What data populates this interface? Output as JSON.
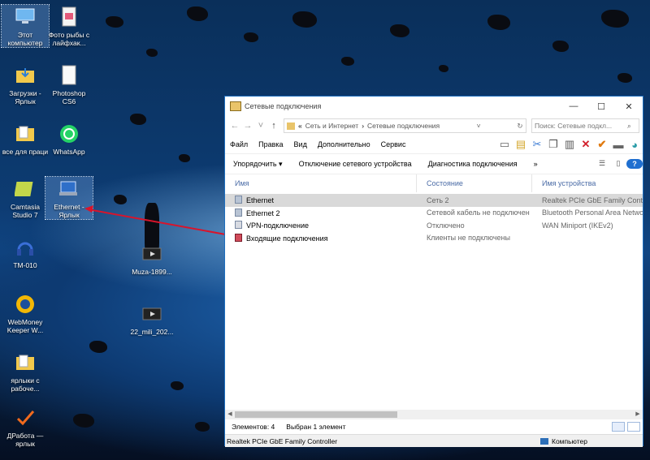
{
  "desktop": {
    "icons": [
      {
        "label": "Этот компьютер",
        "icon": "computer-icon"
      },
      {
        "label": "Фото рыбы с лайфхак...",
        "icon": "document-icon"
      },
      {
        "label": "Загрузки - Ярлык",
        "icon": "downloads-folder-icon"
      },
      {
        "label": "Photoshop CS6",
        "icon": "document-icon"
      },
      {
        "label": "все для праци",
        "icon": "folder-icon"
      },
      {
        "label": "WhatsApp",
        "icon": "whatsapp-icon"
      },
      {
        "label": "Camtasia Studio 7",
        "icon": "camtasia-icon"
      },
      {
        "label": "Ethernet - Ярлык",
        "icon": "network-shortcut-icon"
      },
      {
        "label": "TM-010",
        "icon": "headset-icon"
      },
      {
        "label": "Muza-1899...",
        "icon": "video-file-icon"
      },
      {
        "label": "WebMoney Keeper W...",
        "icon": "webmoney-icon"
      },
      {
        "label": "22_mili_202...",
        "icon": "video-file-icon"
      },
      {
        "label": "ярлыки с рабоче...",
        "icon": "folder-icon"
      },
      {
        "label": "ДРабота — ярлык",
        "icon": "checkmark-icon"
      }
    ]
  },
  "window": {
    "title": "Сетевые подключения",
    "controls": {
      "minimize": "—",
      "maximize": "☐",
      "close": "✕"
    },
    "breadcrumb": {
      "prefix": "«",
      "items": [
        "Сеть и Интернет",
        "Сетевые подключения"
      ]
    },
    "search_placeholder": "Поиск: Сетевые подкл...",
    "menu": [
      "Файл",
      "Правка",
      "Вид",
      "Дополнительно",
      "Сервис"
    ],
    "commands": [
      "Упорядочить ▾",
      "Отключение сетевого устройства",
      "Диагностика подключения",
      "»"
    ],
    "columns": [
      "Имя",
      "Состояние",
      "Имя устройства"
    ],
    "rows": [
      {
        "name": "Ethernet",
        "status": "Сеть  2",
        "device": "Realtek PCIe GbE Family Contro..."
      },
      {
        "name": "Ethernet 2",
        "status": "Сетевой кабель не подключен",
        "device": "Bluetooth Personal Area Network"
      },
      {
        "name": "VPN-подключение",
        "status": "Отключено",
        "device": "WAN Miniport (IKEv2)"
      },
      {
        "name": "Входящие подключения",
        "status": "Клиенты не подключены",
        "device": ""
      }
    ],
    "status_count": "Элементов: 4",
    "status_selected": "Выбран 1 элемент",
    "details_device": "Realtek PCIe GbE Family Controller",
    "details_location": "Компьютер"
  },
  "colors": {
    "accent": "#1e6fbf",
    "annotation_arrow": "#d9142b"
  }
}
